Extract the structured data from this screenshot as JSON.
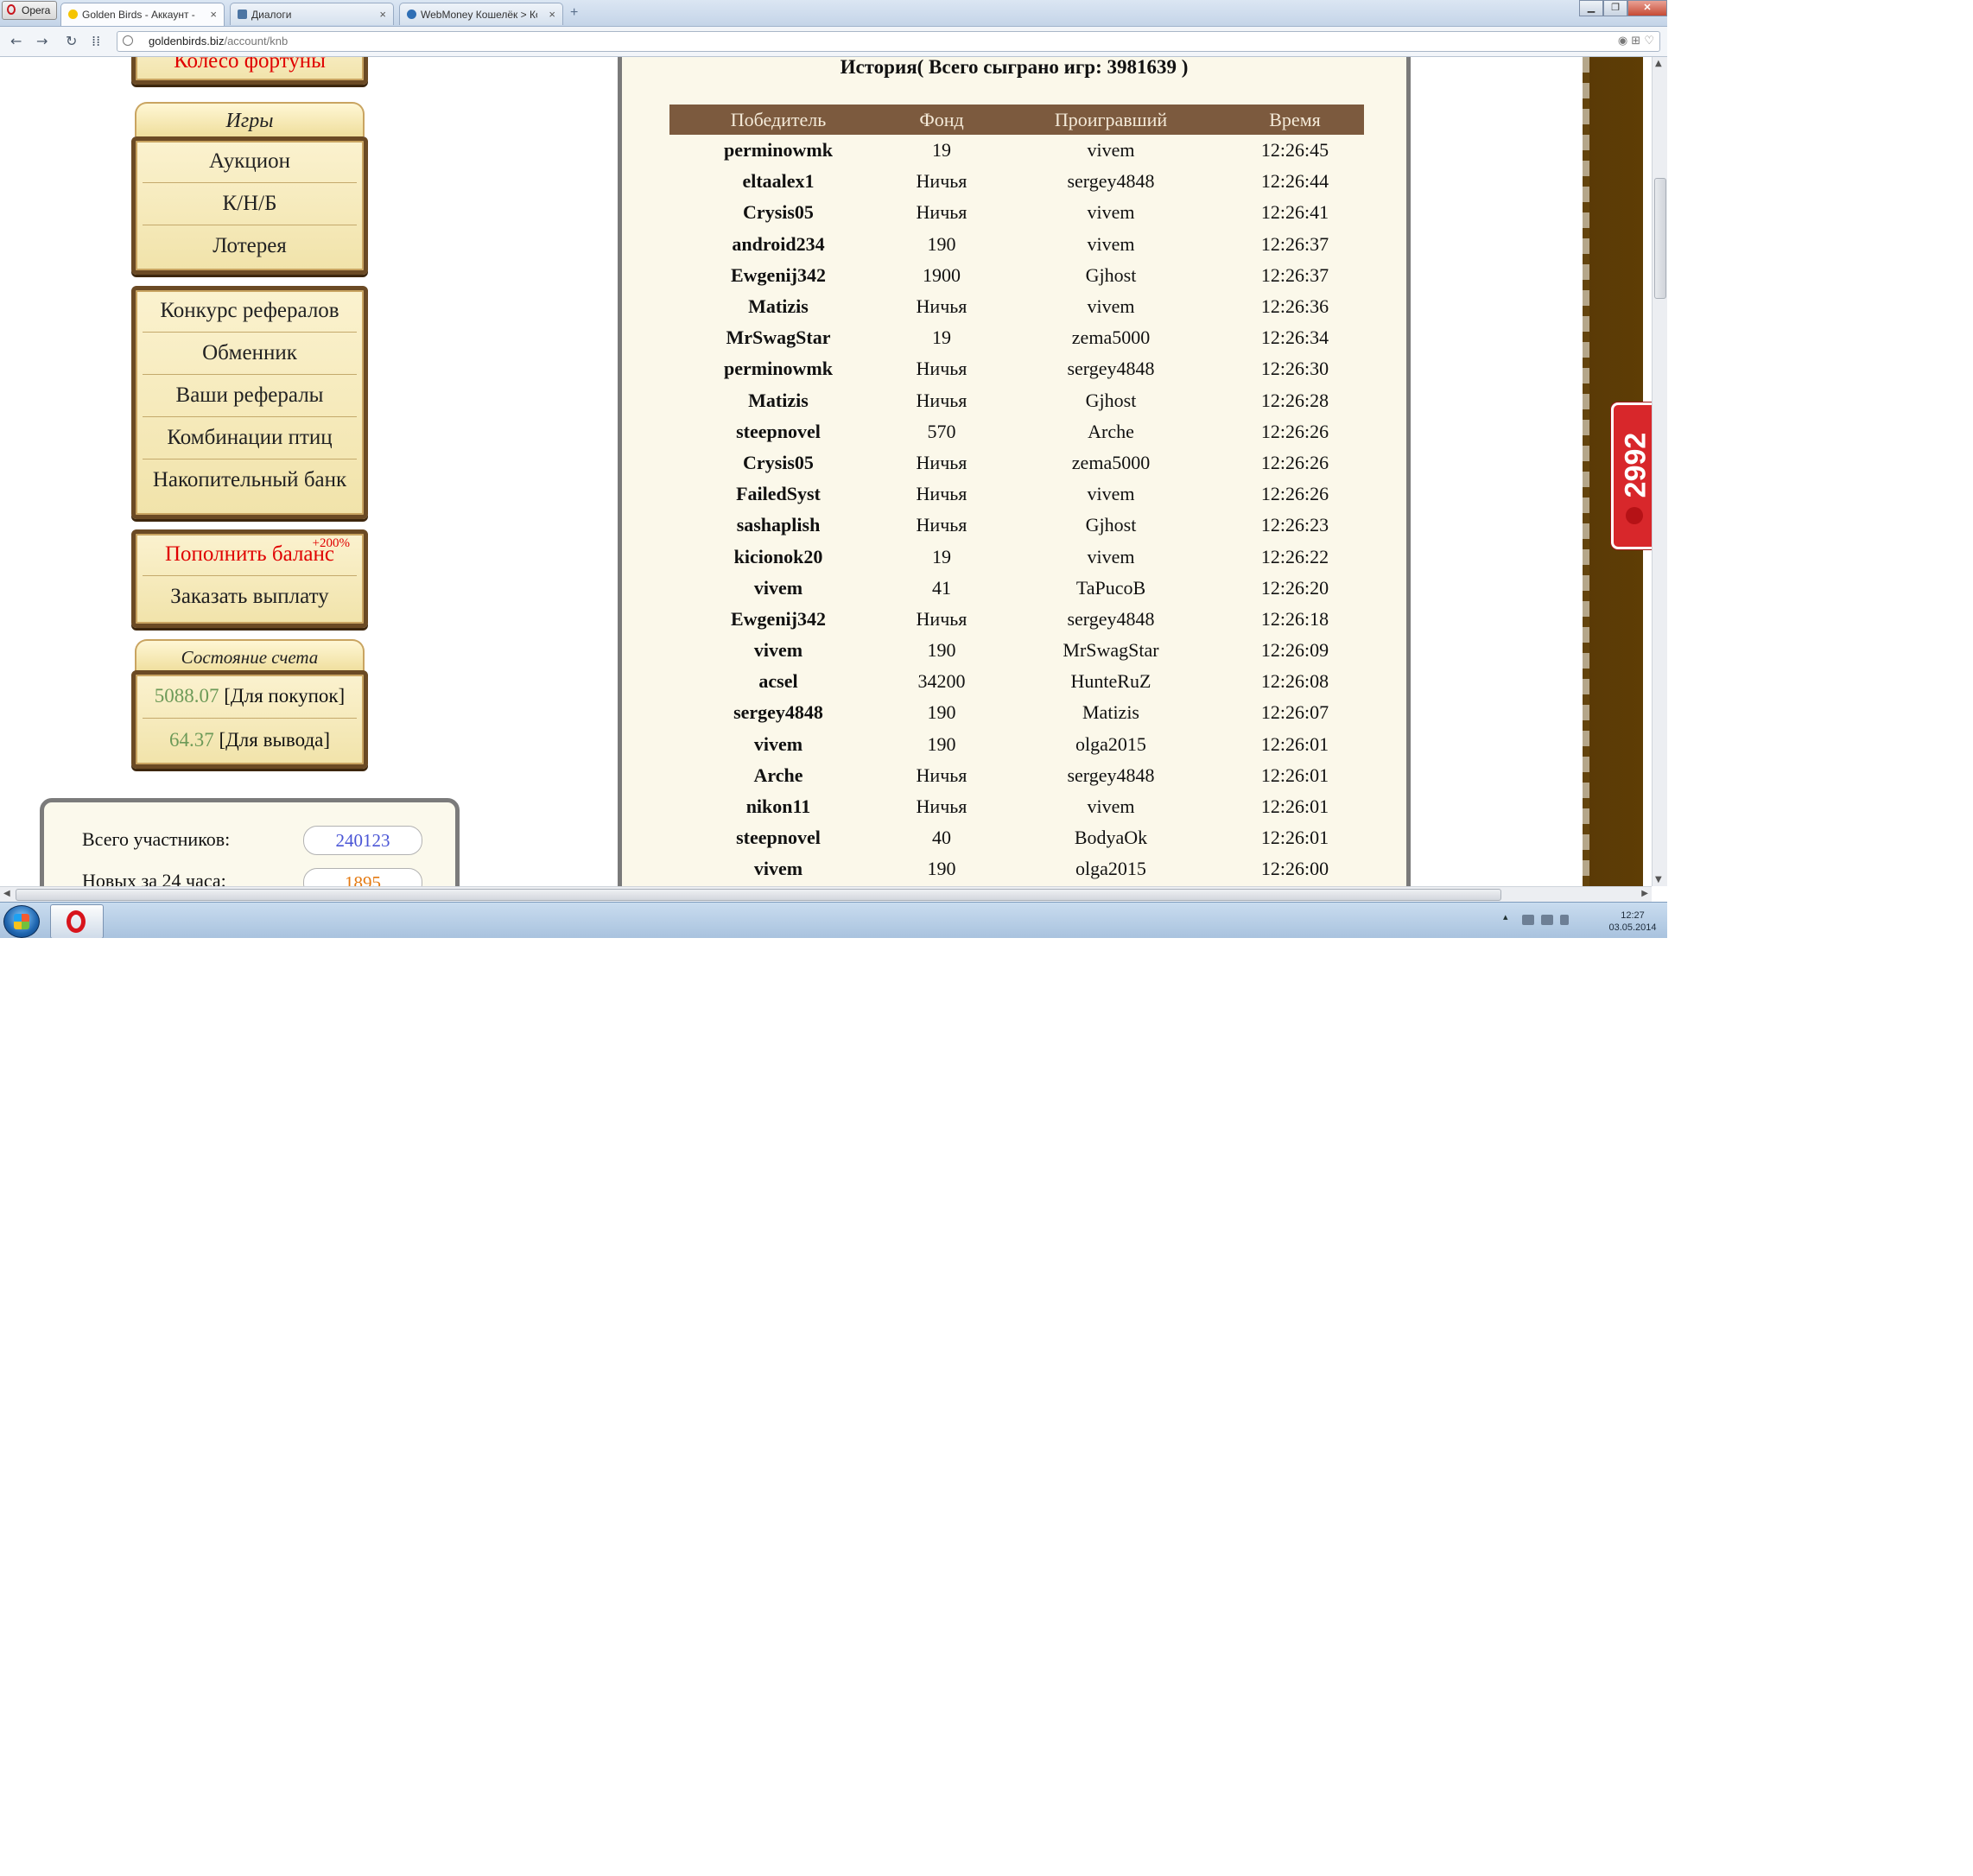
{
  "browser": {
    "menu_label": "Opera",
    "tabs": [
      {
        "label": "Golden Birds - Аккаунт - К",
        "active": true
      },
      {
        "label": "Диалоги",
        "active": false
      },
      {
        "label": "WebMoney Кошелёк > Кош",
        "active": false
      }
    ],
    "new_tab_glyph": "+",
    "close_glyph": "×",
    "url_host": "goldenbirds.biz",
    "url_path": "/account/knb"
  },
  "sidebar": {
    "top_item": "Колесо фортуны",
    "games_header": "Игры",
    "games": [
      "Аукцион",
      "К/Н/Б",
      "Лотерея"
    ],
    "links": [
      "Конкурс рефералов",
      "Обменник",
      "Ваши рефералы",
      "Комбинации птиц",
      "Накопительный банк"
    ],
    "deposit_label": "Пополнить баланс",
    "deposit_bonus": "+200%",
    "withdraw_label": "Заказать выплату",
    "account_header": "Состояние счета",
    "balance_purchase": {
      "value": "5088.07",
      "label": "[Для покупок]"
    },
    "balance_withdraw": {
      "value": "64.37",
      "label": "[Для вывода]"
    }
  },
  "stats": {
    "total_label": "Всего участников:",
    "total_value": "240123",
    "new_label": "Новых за 24 часа:",
    "new_value": "1895"
  },
  "history": {
    "title": "История( Всего сыграно игр: 3981639 )",
    "columns": [
      "Победитель",
      "Фонд",
      "Проигравший",
      "Время"
    ],
    "rows": [
      [
        "perminowmk",
        "19",
        "vivem",
        "12:26:45"
      ],
      [
        "eltaalex1",
        "Ничья",
        "sergey4848",
        "12:26:44"
      ],
      [
        "Crysis05",
        "Ничья",
        "vivem",
        "12:26:41"
      ],
      [
        "android234",
        "190",
        "vivem",
        "12:26:37"
      ],
      [
        "Ewgenij342",
        "1900",
        "Gjhost",
        "12:26:37"
      ],
      [
        "Matizis",
        "Ничья",
        "vivem",
        "12:26:36"
      ],
      [
        "MrSwagStar",
        "19",
        "zema5000",
        "12:26:34"
      ],
      [
        "perminowmk",
        "Ничья",
        "sergey4848",
        "12:26:30"
      ],
      [
        "Matizis",
        "Ничья",
        "Gjhost",
        "12:26:28"
      ],
      [
        "steepnovel",
        "570",
        "Arche",
        "12:26:26"
      ],
      [
        "Crysis05",
        "Ничья",
        "zema5000",
        "12:26:26"
      ],
      [
        "FailedSyst",
        "Ничья",
        "vivem",
        "12:26:26"
      ],
      [
        "sashaplish",
        "Ничья",
        "Gjhost",
        "12:26:23"
      ],
      [
        "kicionok20",
        "19",
        "vivem",
        "12:26:22"
      ],
      [
        "vivem",
        "41",
        "TaPucoB",
        "12:26:20"
      ],
      [
        "Ewgenij342",
        "Ничья",
        "sergey4848",
        "12:26:18"
      ],
      [
        "vivem",
        "190",
        "MrSwagStar",
        "12:26:09"
      ],
      [
        "acsel",
        "34200",
        "HunteRuZ",
        "12:26:08"
      ],
      [
        "sergey4848",
        "190",
        "Matizis",
        "12:26:07"
      ],
      [
        "vivem",
        "190",
        "olga2015",
        "12:26:01"
      ],
      [
        "Arche",
        "Ничья",
        "sergey4848",
        "12:26:01"
      ],
      [
        "nikon11",
        "Ничья",
        "vivem",
        "12:26:01"
      ],
      [
        "steepnovel",
        "40",
        "BodyaOk",
        "12:26:01"
      ],
      [
        "vivem",
        "190",
        "olga2015",
        "12:26:00"
      ]
    ]
  },
  "widget": {
    "counter": "2992"
  },
  "taskbar": {
    "time": "12:27",
    "date": "03.05.2014"
  },
  "colors": {
    "table_header": "#7c5a3e",
    "panel_bg": "#fbf8ea",
    "accent_red": "#e00000",
    "balance_green": "#6d9a58",
    "total_blue": "#4a55d6",
    "new_orange": "#e47a12"
  }
}
